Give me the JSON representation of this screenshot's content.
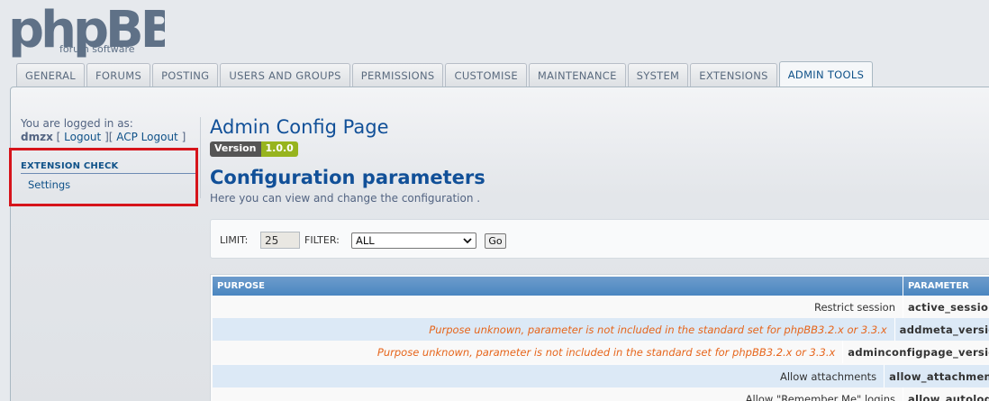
{
  "logo": {
    "text": "phpBB",
    "subtitle": "forum software"
  },
  "tabs": [
    {
      "label": "GENERAL"
    },
    {
      "label": "FORUMS"
    },
    {
      "label": "POSTING"
    },
    {
      "label": "USERS AND GROUPS"
    },
    {
      "label": "PERMISSIONS"
    },
    {
      "label": "CUSTOMISE"
    },
    {
      "label": "MAINTENANCE"
    },
    {
      "label": "SYSTEM"
    },
    {
      "label": "EXTENSIONS"
    },
    {
      "label": "ADMIN TOOLS",
      "active": true
    }
  ],
  "sidebar": {
    "logged_in_label": "You are logged in as:",
    "username": "dmzx",
    "logout": "Logout",
    "acp_logout": "ACP Logout",
    "menu_heading": "EXTENSION CHECK",
    "menu_item": "Settings"
  },
  "main": {
    "title": "Admin Config Page",
    "version_label": "Version",
    "version_value": "1.0.0",
    "section_title": "Configuration parameters",
    "section_desc": "Here you can view and change the configuration ."
  },
  "filter": {
    "limit_label": "LIMIT:",
    "limit_value": "25",
    "filter_label": "FILTER:",
    "filter_value": "ALL",
    "go_label": "Go"
  },
  "table": {
    "headers": {
      "purpose": "PURPOSE",
      "parameter": "PARAMETER"
    },
    "rows": [
      {
        "purpose": "Restrict session",
        "parameter": "active_sessions",
        "unknown": false
      },
      {
        "purpose": "Purpose unknown, parameter is not included in the standard set for phpBB3.2.x or 3.3.x",
        "parameter": "addmeta_version",
        "unknown": true
      },
      {
        "purpose": "Purpose unknown, parameter is not included in the standard set for phpBB3.2.x or 3.3.x",
        "parameter": "adminconfigpage_version",
        "unknown": true
      },
      {
        "purpose": "Allow attachments",
        "parameter": "allow_attachments",
        "unknown": false
      },
      {
        "purpose": "Allow \"Remember Me\" logins",
        "parameter": "allow_autologin",
        "unknown": false
      }
    ]
  },
  "colors": {
    "accent": "#105289",
    "highlight": "#d6141b",
    "warning": "#e6651b"
  }
}
